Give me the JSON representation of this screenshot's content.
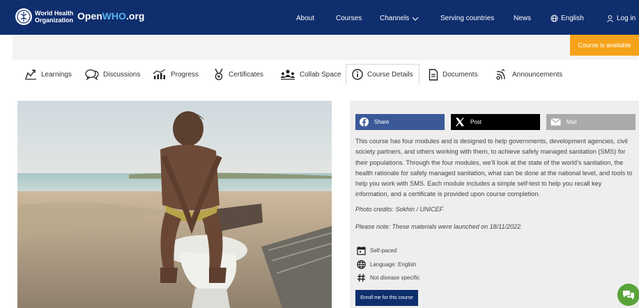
{
  "header": {
    "who_name": "World Health Organization",
    "brand_prefix": "Open",
    "brand_accent": "WHO",
    "brand_suffix": ".org",
    "nav": {
      "about": "About",
      "courses": "Courses",
      "channels": "Channels",
      "serving": "Serving countries",
      "news": "News",
      "language": "English",
      "login": "Log in"
    }
  },
  "status_badge": "Course is available",
  "tabs": [
    {
      "label": "Learnings"
    },
    {
      "label": "Discussions"
    },
    {
      "label": "Progress"
    },
    {
      "label": "Certificates"
    },
    {
      "label": "Collab Space"
    },
    {
      "label": "Course Details"
    },
    {
      "label": "Documents"
    },
    {
      "label": "Announcements"
    }
  ],
  "share": {
    "share": "Share",
    "post": "Post",
    "mail": "Mail"
  },
  "description": "This course has four modules and is designed to help governments, development agencies, civil society partners, and others working with them, to achieve safely managed sanitation (SMS) for their populations. Through the four modules, we’ll look at the state of the world’s sanitation, the health rationale for safely managed sanitation, what can be done at the national level, and tools to help you work with SMS. Each module includes a simple self-test to help you recall key information, and a certificate is provided upon course completion.",
  "photo_credit": "Photo credits: Sokhin / UNICEF",
  "note": "Please note: These materials were launched on 18/11/2022.",
  "meta": {
    "pace": "Self-paced",
    "language": "Language: English",
    "disease": "Not disease specific"
  },
  "enroll_label": "Enroll me for this course",
  "colors": {
    "header_bg": "#0f2e6e",
    "accent": "#57b4ef",
    "badge": "#f6a31a",
    "facebook": "#3b5998",
    "chat": "#5aa33a"
  }
}
